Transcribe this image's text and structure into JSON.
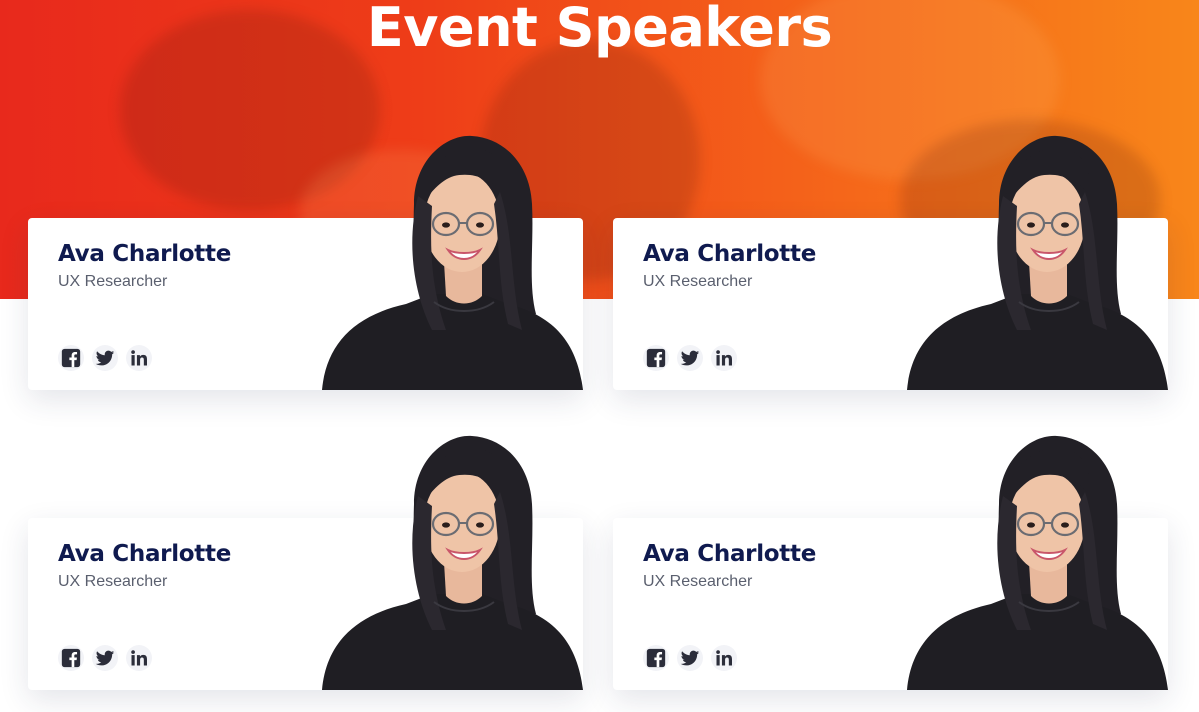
{
  "section": {
    "title": "Event Speakers"
  },
  "colors": {
    "hero_start": "#e8291c",
    "hero_end": "#f8861a",
    "name": "#0f1a4f",
    "role": "#5a5f6e"
  },
  "speakers": [
    {
      "name": "Ava Charlotte",
      "role": "UX Researcher",
      "socials": [
        "facebook-icon",
        "twitter-icon",
        "linkedin-icon"
      ]
    },
    {
      "name": "Ava Charlotte",
      "role": "UX Researcher",
      "socials": [
        "facebook-icon",
        "twitter-icon",
        "linkedin-icon"
      ]
    },
    {
      "name": "Ava Charlotte",
      "role": "UX Researcher",
      "socials": [
        "facebook-icon",
        "twitter-icon",
        "linkedin-icon"
      ]
    },
    {
      "name": "Ava Charlotte",
      "role": "UX Researcher",
      "socials": [
        "facebook-icon",
        "twitter-icon",
        "linkedin-icon"
      ]
    }
  ]
}
